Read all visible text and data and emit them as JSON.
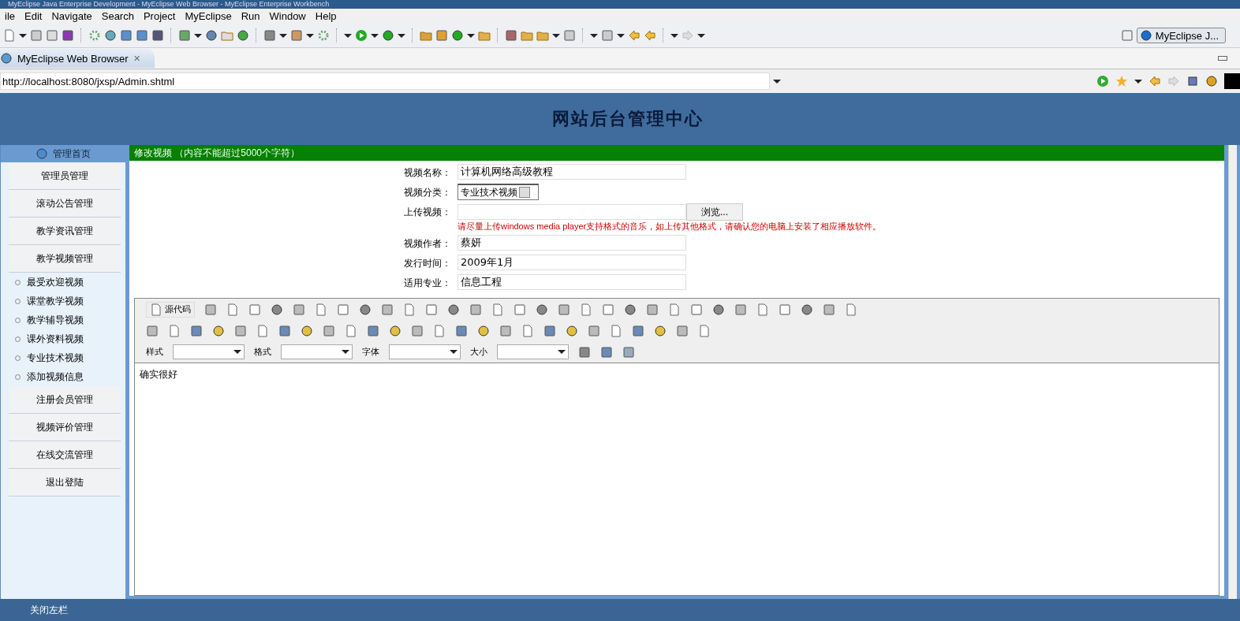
{
  "window": {
    "title": "MyEclipse Java Enterprise Development - MyEclipse Web Browser - MyEclipse Enterprise Workbench"
  },
  "menu": [
    "ile",
    "Edit",
    "Navigate",
    "Search",
    "Project",
    "MyEclipse",
    "Run",
    "Window",
    "Help"
  ],
  "perspective": {
    "label": "MyEclipse J..."
  },
  "tabs": [
    {
      "label": "MyEclipse Web Browser",
      "selected": true,
      "close": "✕"
    }
  ],
  "address": {
    "value": "http://localhost:8080/jxsp/Admin.shtml"
  },
  "page": {
    "title": "网站后台管理中心",
    "sidebar": {
      "header": "管理首页",
      "items": [
        {
          "kind": "section",
          "label": "管理员管理"
        },
        {
          "kind": "section",
          "label": "滚动公告管理"
        },
        {
          "kind": "section",
          "label": "教学资讯管理"
        },
        {
          "kind": "section",
          "label": "教学视频管理"
        },
        {
          "kind": "sub",
          "label": "最受欢迎视频"
        },
        {
          "kind": "sub",
          "label": "课堂教学视频"
        },
        {
          "kind": "sub",
          "label": "教学辅导视频"
        },
        {
          "kind": "sub",
          "label": "课外资料视频"
        },
        {
          "kind": "sub",
          "label": "专业技术视频"
        },
        {
          "kind": "sub",
          "label": "添加视频信息"
        },
        {
          "kind": "section",
          "label": "注册会员管理"
        },
        {
          "kind": "section",
          "label": "视频评价管理"
        },
        {
          "kind": "section",
          "label": "在线交流管理"
        },
        {
          "kind": "section",
          "label": "退出登陆"
        }
      ]
    },
    "panel_title": "修改视频 （内容不能超过5000个字符）",
    "form": [
      {
        "kind": "text",
        "label": "视频名称：",
        "value": "计算机网络高级教程"
      },
      {
        "kind": "select",
        "label": "视频分类：",
        "value": "专业技术视频"
      },
      {
        "kind": "file",
        "label": "上传视频：",
        "button": "浏览...",
        "note": "请尽量上传windows media player支持格式的音乐，如上传其他格式，请确认您的电脑上安装了相应播放软件。"
      },
      {
        "kind": "text",
        "label": "视频作者：",
        "value": "蔡妍"
      },
      {
        "kind": "text",
        "label": "发行时间：",
        "value": "2009年1月"
      },
      {
        "kind": "text",
        "label": "适用专业：",
        "value": "信息工程"
      }
    ],
    "editor": {
      "source_button": "源代码",
      "dropdowns": [
        "样式",
        "格式",
        "字体",
        "大小"
      ],
      "content": "确实很好"
    },
    "footer": "关闭左栏"
  }
}
